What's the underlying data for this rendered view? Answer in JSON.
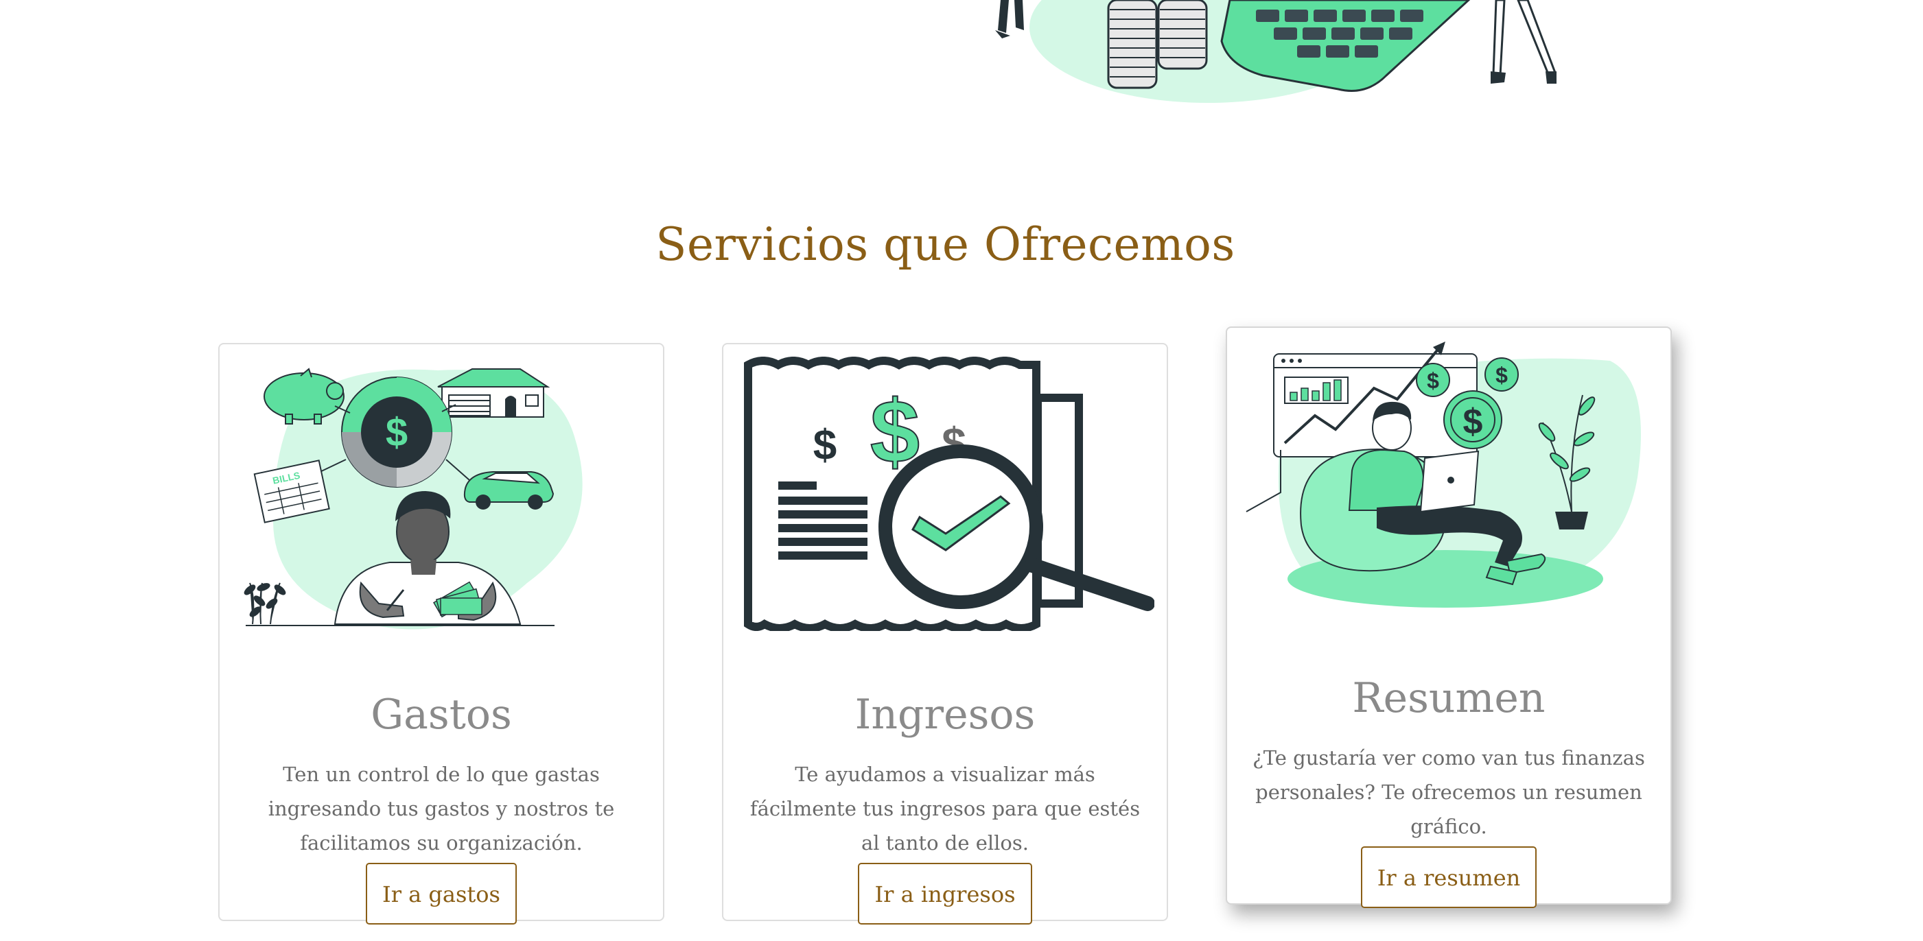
{
  "colors": {
    "accent_gold": "#8a5e16",
    "title_gray": "#8a8a8a",
    "text_gray": "#6a6a6a",
    "illustration_green": "#5ddf9f",
    "illustration_light_green": "#d4f8e6",
    "illustration_dark": "#263238"
  },
  "section": {
    "title": "Servicios que Ofrecemos"
  },
  "cards": [
    {
      "illustration": "budget-planning-illustration",
      "title": "Gastos",
      "description": "Ten un control de lo que gastas ingresando tus gastos y nostros te facilitamos su organización.",
      "button_label": "Ir a gastos"
    },
    {
      "illustration": "income-receipt-illustration",
      "title": "Ingresos",
      "description": "Te ayudamos a visualizar más fácilmente tus ingresos para que estés al tanto de ellos.",
      "button_label": "Ir a ingresos"
    },
    {
      "illustration": "finance-summary-illustration",
      "title": "Resumen",
      "description": "¿Te gustaría ver como van tus finanzas personales? Te ofrecemos un resumen gráfico.",
      "button_label": "Ir a resumen"
    }
  ],
  "illustration_text": {
    "bills_label": "BILLS"
  }
}
